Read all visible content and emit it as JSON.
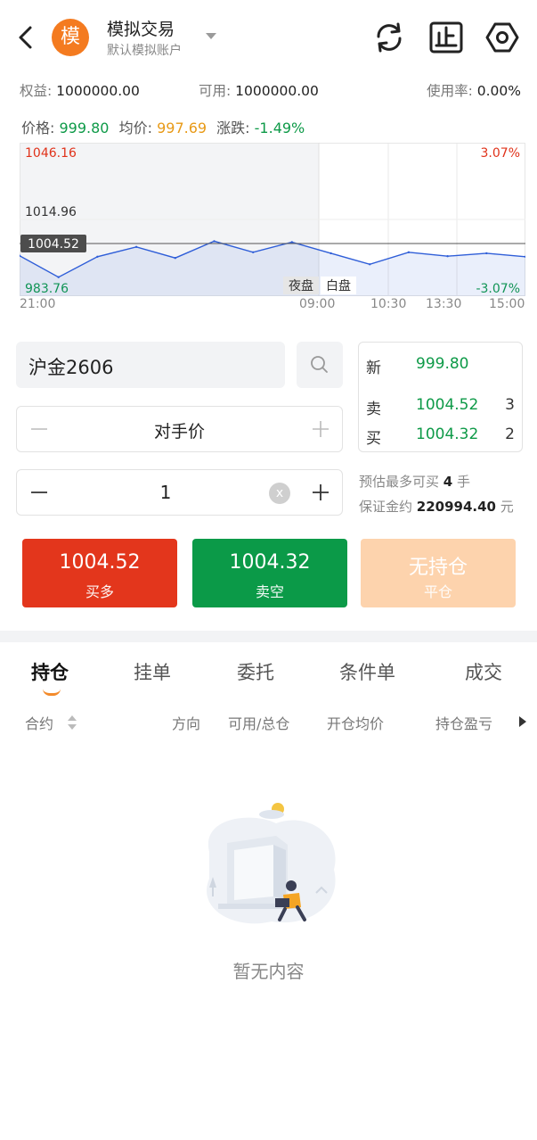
{
  "header": {
    "avatar_char": "模",
    "title": "模拟交易",
    "subtitle": "默认模拟账户"
  },
  "stats": {
    "equity_label": "权益:",
    "equity_value": "1000000.00",
    "available_label": "可用:",
    "available_value": "1000000.00",
    "usage_label": "使用率:",
    "usage_value": "0.00%"
  },
  "price_row": {
    "price_label": "价格:",
    "price_value": "999.80",
    "avg_label": "均价:",
    "avg_value": "997.69",
    "change_label": "涨跌:",
    "change_value": "-1.49%"
  },
  "chart": {
    "type": "line",
    "y_top": "1046.16",
    "y_mid": "1014.96",
    "y_bottom": "983.76",
    "current_price": "1004.52",
    "pct_top": "3.07%",
    "pct_bottom": "-3.07%",
    "night_label": "夜盘",
    "day_label": "白盘",
    "times": [
      "21:00",
      "09:00",
      "10:30",
      "13:30",
      "15:00"
    ],
    "colors": {
      "up": "#e0321a",
      "down": "#0e9a48",
      "price_line": "#2f5ed8",
      "avg_line": "#e8a23a"
    }
  },
  "chart_data": {
    "type": "line",
    "x": [
      "21:00",
      "09:00",
      "10:30",
      "13:30",
      "15:00"
    ],
    "ylim": [
      983.76,
      1046.16
    ],
    "series": [
      {
        "values": [
          1000.2,
          991.5,
          999.8,
          1003.8,
          999.3,
          1006.1,
          1001.6,
          1005.7,
          1001.2,
          996.7,
          1001.6,
          1000.0,
          1001.2,
          999.8
        ]
      }
    ]
  },
  "trade": {
    "symbol": "沪金2606",
    "quote_new_label": "新",
    "quote_new_value": "999.80",
    "quote_sell_label": "卖",
    "quote_sell_price": "1004.52",
    "quote_sell_qty": "3",
    "quote_buy_label": "买",
    "quote_buy_price": "1004.32",
    "quote_buy_qty": "2",
    "price_type": "对手价",
    "quantity": "1",
    "clear_char": "x",
    "est_max_prefix": "预估最多可买",
    "est_max_value": "4",
    "est_max_unit": "手",
    "margin_prefix": "保证金约",
    "margin_value": "220994.40",
    "margin_unit": "元"
  },
  "buttons": {
    "buy_price": "1004.52",
    "buy_label": "买多",
    "sell_price": "1004.32",
    "sell_label": "卖空",
    "close_price": "无持仓",
    "close_label": "平仓"
  },
  "tabs": [
    "持仓",
    "挂单",
    "委托",
    "条件单",
    "成交"
  ],
  "columns": [
    "合约",
    "方向",
    "可用/总仓",
    "开仓均价",
    "持仓盈亏"
  ],
  "empty": {
    "text": "暂无内容"
  }
}
